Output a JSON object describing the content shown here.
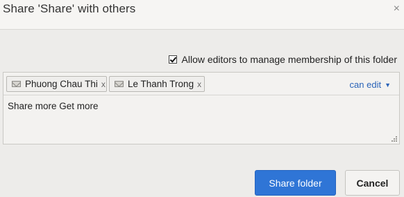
{
  "dialog": {
    "title": "Share 'Share' with others",
    "close_glyph": "×"
  },
  "options": {
    "allow_editors_label": "Allow editors to manage membership of this folder",
    "allow_editors_checked": true
  },
  "recipients": [
    {
      "name": "Phuong Chau Thi",
      "remove": "x",
      "icon": "mail-icon"
    },
    {
      "name": "Le Thanh Trong",
      "remove": "x",
      "icon": "mail-icon"
    }
  ],
  "permission": {
    "label": "can edit",
    "caret": "▼"
  },
  "message": {
    "value": "Share more Get more"
  },
  "buttons": {
    "share": "Share folder",
    "cancel": "Cancel"
  }
}
